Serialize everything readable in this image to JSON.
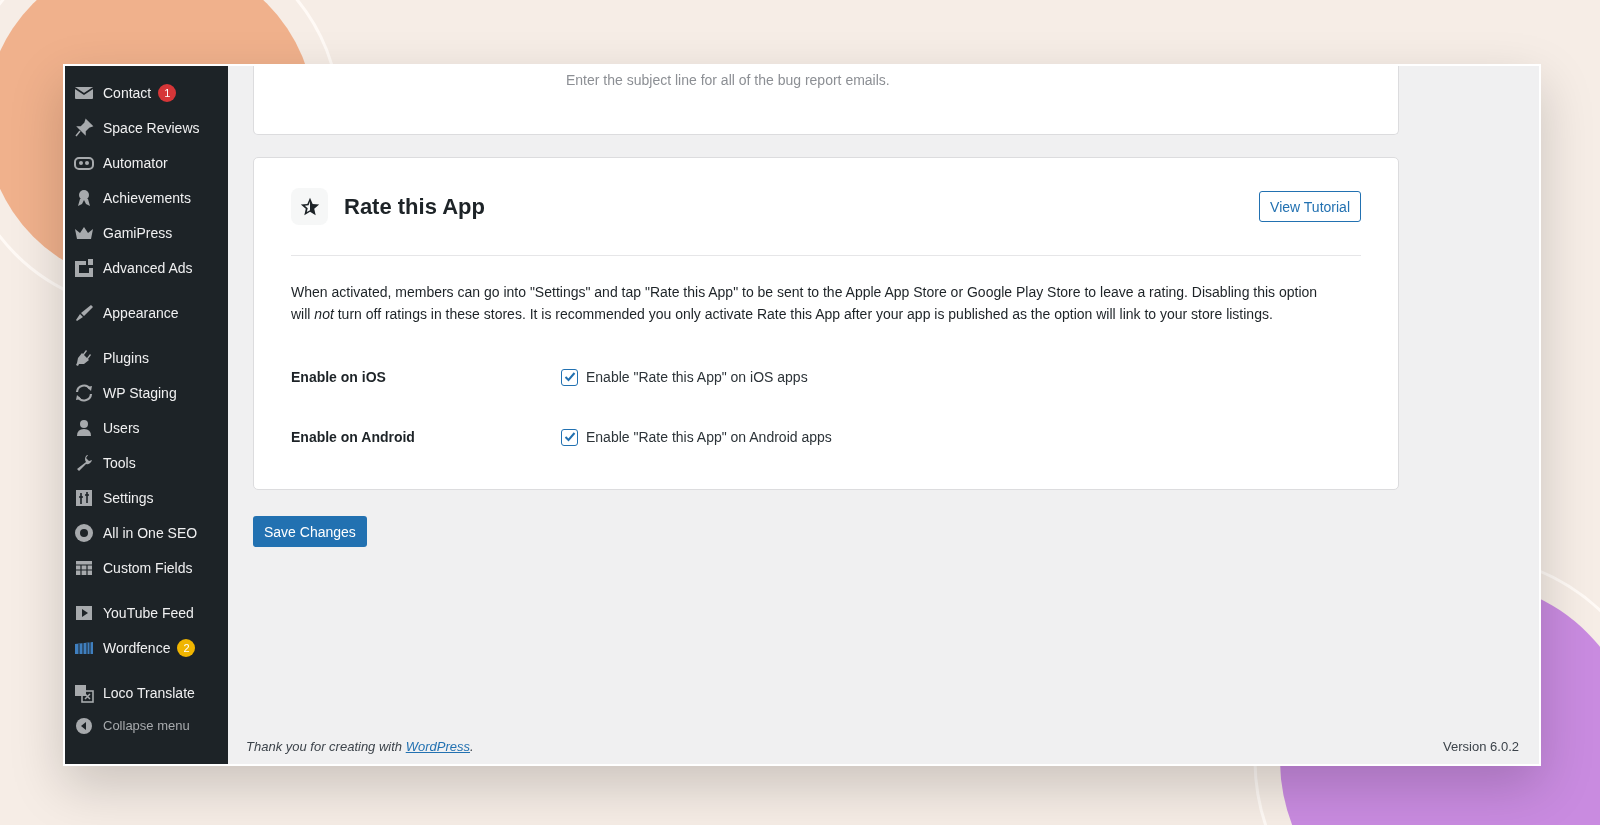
{
  "sidebar": {
    "groups": [
      {
        "items": [
          {
            "kind": "envelope",
            "label": "Contact",
            "badge": {
              "text": "1",
              "color": "#d63638"
            }
          },
          {
            "kind": "pin",
            "label": "Space Reviews"
          },
          {
            "kind": "robot",
            "label": "Automator"
          },
          {
            "kind": "ribbon",
            "label": "Achievements"
          },
          {
            "kind": "crown",
            "label": "GamiPress"
          },
          {
            "kind": "square",
            "label": "Advanced Ads"
          }
        ]
      },
      {
        "items": [
          {
            "kind": "brush",
            "label": "Appearance"
          }
        ]
      },
      {
        "items": [
          {
            "kind": "plug",
            "label": "Plugins"
          },
          {
            "kind": "sync",
            "label": "WP Staging"
          },
          {
            "kind": "person",
            "label": "Users"
          },
          {
            "kind": "wrench",
            "label": "Tools"
          },
          {
            "kind": "sliders",
            "label": "Settings"
          },
          {
            "kind": "gear",
            "label": "All in One SEO"
          },
          {
            "kind": "grid",
            "label": "Custom Fields"
          }
        ]
      },
      {
        "items": [
          {
            "kind": "play",
            "label": "YouTube Feed"
          },
          {
            "kind": "fence",
            "label": "Wordfence",
            "badge": {
              "text": "2",
              "color": "#f0b500"
            }
          }
        ]
      },
      {
        "items": [
          {
            "kind": "translate",
            "label": "Loco Translate"
          }
        ]
      }
    ],
    "collapse": "Collapse menu"
  },
  "top_card": {
    "hint": "Enter the subject line for all of the bug report emails."
  },
  "card": {
    "title": "Rate this App",
    "tutorial_button": "View Tutorial",
    "description": "When activated, members can go into \"Settings\" and tap \"Rate this App\" to be sent to the Apple App Store or Google Play Store to leave a rating. Disabling this option will *not* turn off ratings in these stores. It is recommended you only activate Rate this App after your app is published as the option will link to your store listings.",
    "options": [
      {
        "label": "Enable on iOS",
        "checkbox_label": "Enable \"Rate this App\" on iOS apps",
        "checked": true
      },
      {
        "label": "Enable on Android",
        "checkbox_label": "Enable \"Rate this App\" on Android apps",
        "checked": true
      }
    ]
  },
  "save_button": "Save Changes",
  "footer": {
    "thanks": "Thank you for creating with ",
    "link": "WordPress",
    "after": ".",
    "version": "Version 6.0.2"
  }
}
